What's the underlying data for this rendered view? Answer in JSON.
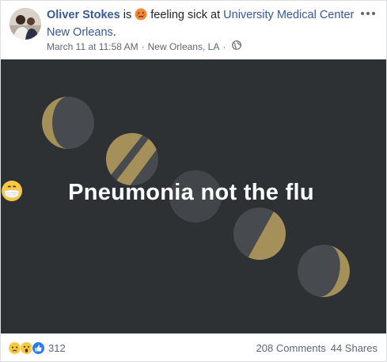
{
  "post": {
    "author": "Oliver Stokes",
    "verb": "is",
    "feeling": "feeling sick at",
    "place": "University Medical Center New Orleans",
    "place_suffix": ".",
    "timestamp": "March 11 at 11:58 AM",
    "separator": "·",
    "location": "New Orleans, LA",
    "privacy_icon": "globe-icon",
    "feeling_icon": "sick-face-emoji-icon",
    "menu_icon": "more-options-icon"
  },
  "image": {
    "headline": "Pneumonia not the flu",
    "emoji_icon": "face-with-medical-mask-emoji-icon",
    "background_color": "#2e3134",
    "moon_color": "#a6905a"
  },
  "footer": {
    "reaction_icons": [
      "sad-reaction-icon",
      "wow-reaction-icon",
      "like-reaction-icon"
    ],
    "reaction_count": "312",
    "comments": "208 Comments",
    "shares": "44 Shares"
  },
  "colors": {
    "link": "#385898",
    "meta": "#616770"
  }
}
